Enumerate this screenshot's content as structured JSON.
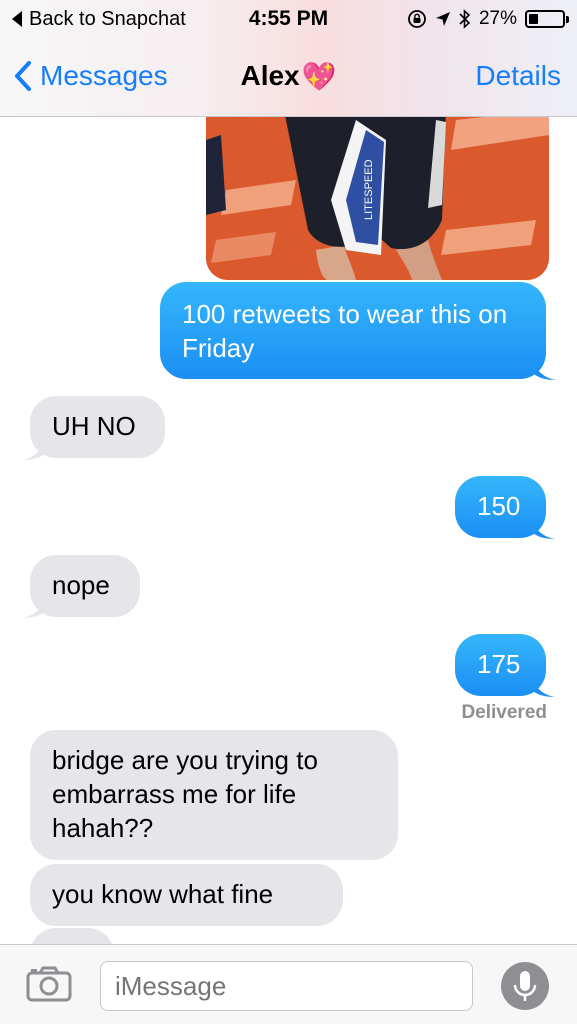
{
  "status_bar": {
    "back_app": "Back to Snapchat",
    "time": "4:55 PM",
    "battery": "27%",
    "battery_level": 0.27,
    "icons": [
      "orientation-lock-icon",
      "location-arrow-icon",
      "bluetooth-icon",
      "battery-icon"
    ]
  },
  "nav": {
    "back_label": "Messages",
    "contact_name": "Alex",
    "contact_emoji": "💖",
    "details_label": "Details"
  },
  "messages": [
    {
      "direction": "out",
      "type": "photo"
    },
    {
      "direction": "out",
      "text": "100 retweets to wear this on Friday"
    },
    {
      "direction": "in",
      "text": "UH NO"
    },
    {
      "direction": "out",
      "text": "150"
    },
    {
      "direction": "in",
      "text": "nope"
    },
    {
      "direction": "out",
      "text": "175"
    },
    {
      "direction": "in",
      "text": "bridge are you trying to embarrass me for life hahah??"
    },
    {
      "direction": "in",
      "text": "you know what fine"
    }
  ],
  "photo_text": "LITESPEED",
  "delivered_label": "Delivered",
  "input": {
    "placeholder": "iMessage"
  },
  "colors": {
    "ios_blue": "#157efb",
    "outgoing_bubble": "#1d9bf6",
    "incoming_bubble": "#e5e5ea",
    "secondary_text": "#8e8e93"
  }
}
